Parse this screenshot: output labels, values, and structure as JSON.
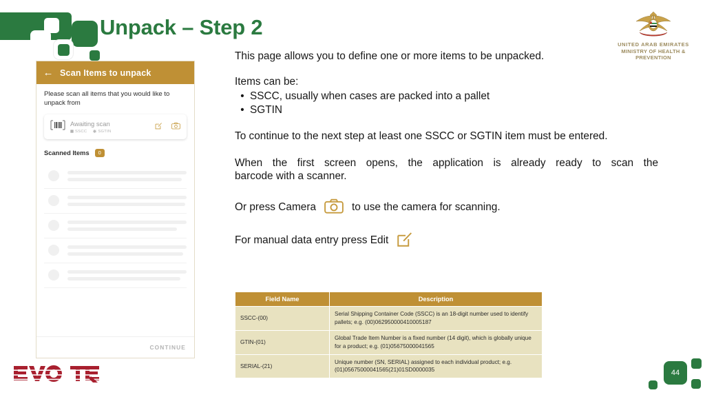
{
  "slide": {
    "title": "Unpack – Step 2",
    "page_number": "44",
    "brand_color_green": "#2b7a40",
    "brand_color_gold": "#bf9035",
    "evoteq_color": "#a81f2e",
    "evoteq_wordmark": "EVOTEQ"
  },
  "emblem": {
    "line1": "UNITED ARAB EMIRATES",
    "line2": "MINISTRY OF HEALTH & PREVENTION"
  },
  "phone": {
    "back_icon": "arrow-left-icon",
    "header_title": "Scan Items to unpack",
    "instruction": "Please scan all items that you would like to unpack from",
    "scan_card": {
      "barcode_icon": "barcode-icon",
      "status": "Awaiting scan",
      "tag_sscc": "SSCC",
      "tag_sgtin": "SGTIN",
      "edit_icon": "edit-icon",
      "camera_icon": "camera-icon"
    },
    "scanned_items_label": "Scanned Items",
    "scanned_items_count": "0",
    "skeleton_row_count": 5,
    "continue_label": "CONTINUE"
  },
  "body": {
    "intro": "This page allows you to define one or more items to be unpacked.",
    "items_can_be_label": "Items can be:",
    "bullet_char": "•",
    "bullets": [
      "SSCC, usually when cases are packed into a pallet",
      "SGTIN"
    ],
    "continue_note": "To continue to the next step at least one SSCC or SGTIN item must be entered.",
    "first_screen_note_line1": "When the first screen opens,  the application is already ready to scan the",
    "first_screen_note_line2": "barcode with a scanner.",
    "camera_line_before": "Or press Camera",
    "camera_line_after": "to use the camera for scanning.",
    "edit_line_before": "For manual data entry press Edit"
  },
  "table": {
    "headers": [
      "Field Name",
      "Description"
    ],
    "rows": [
      {
        "field": "SSCC-(00)",
        "description": "Serial Shipping Container Code (SSCC) is an 18-digit number used to identify pallets; e.g. (00)062950000410005187"
      },
      {
        "field": "GTIN-(01)",
        "description": "Global Trade Item Number is a fixed number (14 digit), which is globally unique for a product; e.g. (01)05675000041565"
      },
      {
        "field": "SERIAL-(21)",
        "description": "Unique number (SN, SERIAL) assigned to each individual product; e.g. (01)05675000041565(21)01SD0000035"
      }
    ]
  }
}
